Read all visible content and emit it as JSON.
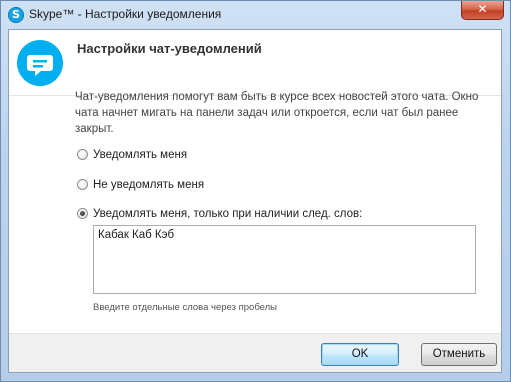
{
  "window": {
    "title": "Skype™ - Настройки уведомления",
    "app_icon_letter": "S",
    "close_glyph": "✕"
  },
  "header": {
    "title": "Настройки чат-уведомлений",
    "icon": "chat-bubble-icon"
  },
  "description": "Чат-уведомления помогут вам быть в курсе всех новостей этого чата. Окно чата начнет мигать на панели задач или откроется, если чат был ранее закрыт.",
  "options": [
    {
      "label": "Уведомлять меня",
      "selected": false
    },
    {
      "label": "Не уведомлять меня",
      "selected": false
    },
    {
      "label": "Уведомлять меня, только при наличии след. слов:",
      "selected": true
    }
  ],
  "keywords": {
    "value": "Кабак Каб Кэб",
    "hint": "Введите отдельные слова через пробелы"
  },
  "buttons": {
    "ok": "OK",
    "cancel": "Отменить"
  },
  "colors": {
    "accent": "#00aff0",
    "close": "#c24124"
  }
}
